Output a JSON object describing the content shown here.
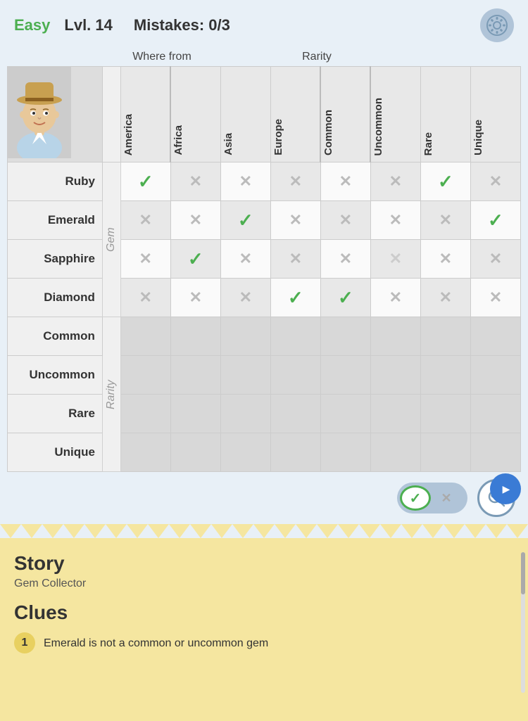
{
  "header": {
    "difficulty": "Easy",
    "level": "Lvl. 14",
    "mistakes_label": "Mistakes: 0/3"
  },
  "group_labels": {
    "where_from": "Where from",
    "rarity": "Rarity"
  },
  "columns": [
    {
      "id": "america",
      "label": "America",
      "group": "where"
    },
    {
      "id": "africa",
      "label": "Africa",
      "group": "where"
    },
    {
      "id": "asia",
      "label": "Asia",
      "group": "where"
    },
    {
      "id": "europe",
      "label": "Europe",
      "group": "where"
    },
    {
      "id": "common",
      "label": "Common",
      "group": "rarity"
    },
    {
      "id": "uncommon",
      "label": "Uncommon",
      "group": "rarity"
    },
    {
      "id": "rare",
      "label": "Rare",
      "group": "rarity"
    },
    {
      "id": "unique",
      "label": "Unique",
      "group": "rarity"
    }
  ],
  "rows": [
    {
      "label": "Ruby",
      "side_group": "Gem",
      "cells": [
        "check",
        "x",
        "x",
        "x",
        "x",
        "x",
        "check",
        "x"
      ]
    },
    {
      "label": "Emerald",
      "side_group": "",
      "cells": [
        "x",
        "x",
        "check",
        "x",
        "x",
        "x",
        "x",
        "check"
      ]
    },
    {
      "label": "Sapphire",
      "side_group": "",
      "cells": [
        "x",
        "check",
        "x",
        "x",
        "x",
        "x",
        "x",
        "x"
      ]
    },
    {
      "label": "Diamond",
      "side_group": "",
      "cells": [
        "x",
        "x",
        "x",
        "check",
        "check",
        "x",
        "x",
        "x"
      ]
    },
    {
      "label": "Common",
      "side_group": "Rarity",
      "cells": [
        "empty",
        "empty",
        "empty",
        "empty",
        "empty",
        "empty",
        "empty",
        "empty"
      ]
    },
    {
      "label": "Uncommon",
      "side_group": "",
      "cells": [
        "empty",
        "empty",
        "empty",
        "empty",
        "empty",
        "empty",
        "empty",
        "empty"
      ]
    },
    {
      "label": "Rare",
      "side_group": "",
      "cells": [
        "empty",
        "empty",
        "empty",
        "empty",
        "empty",
        "empty",
        "empty",
        "empty"
      ]
    },
    {
      "label": "Unique",
      "side_group": "",
      "cells": [
        "empty",
        "empty",
        "empty",
        "empty",
        "empty",
        "empty",
        "empty",
        "empty"
      ]
    }
  ],
  "story": {
    "title": "Story",
    "subtitle": "Gem Collector",
    "clues_title": "Clues",
    "clues": [
      {
        "number": "1",
        "text": "Emerald is not a common or uncommon gem"
      }
    ]
  },
  "toggle": {
    "check_symbol": "✓",
    "x_symbol": "✕"
  },
  "gear_icon": "⚙",
  "search_icon": "🔍",
  "play_icon": "▶"
}
